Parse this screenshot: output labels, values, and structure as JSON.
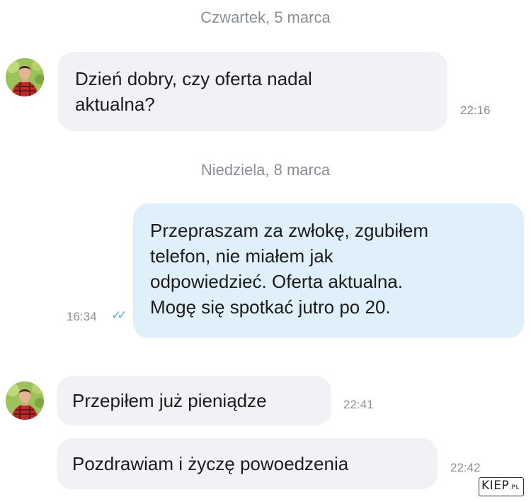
{
  "chat": {
    "date_1": "Czwartek, 5 marca",
    "msg_1": {
      "text": "Dzień dobry, czy oferta nadal\naktualna?",
      "time": "22:16"
    },
    "date_2": "Niedziela, 8 marca",
    "msg_2": {
      "text": "Przepraszam za zwłokę, zgubiłem\ntelefon, nie miałem jak\nodpowiedzieć. Oferta aktualna.\nMogę się spotkać jutro po 20.",
      "time": "16:34",
      "status_icon": "double-check-icon",
      "status_color": "#5da7e0"
    },
    "msg_3": {
      "text": "Przepiłem już pieniądze",
      "time": "22:41"
    },
    "msg_4": {
      "text": "Pozdrawiam i życzę powoedzenia",
      "time": "22:42"
    }
  },
  "watermark": {
    "main": "KIEP",
    "suffix": ".PL"
  },
  "colors": {
    "incoming_bubble": "#f1f2f5",
    "outgoing_bubble": "#dff0fb",
    "meta_text": "#8a8f95"
  }
}
